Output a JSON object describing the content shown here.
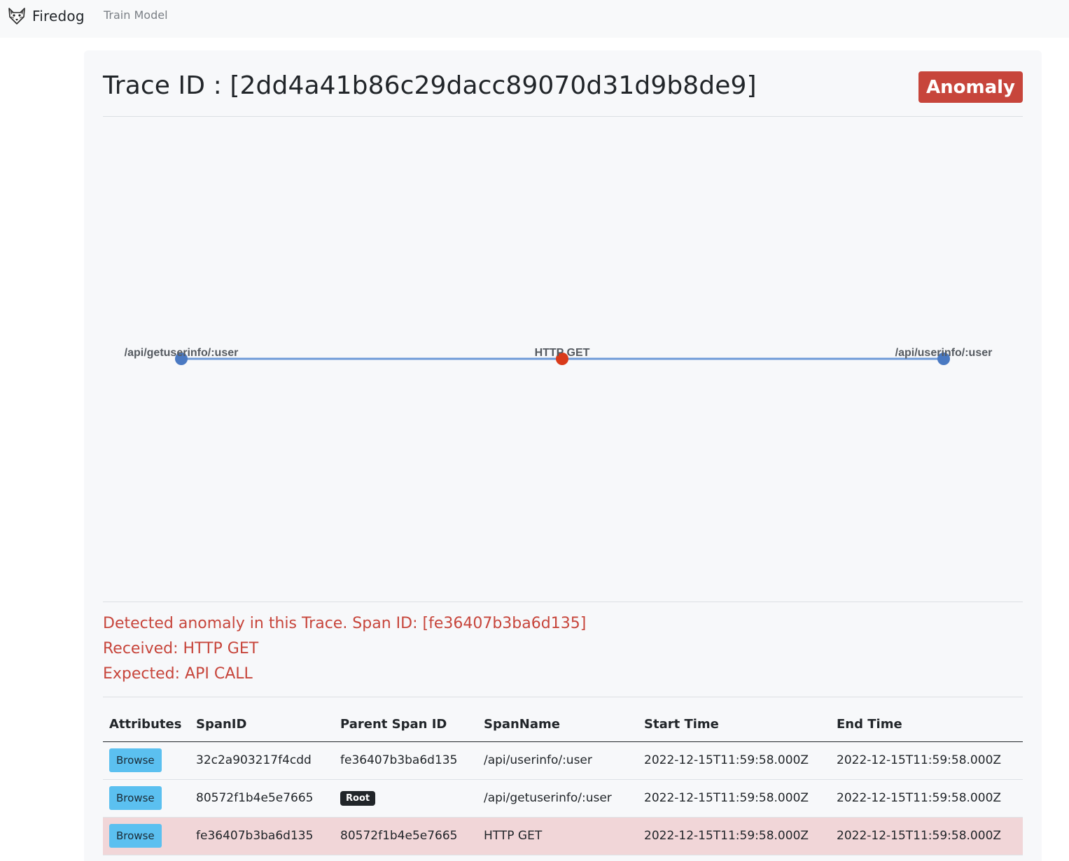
{
  "navbar": {
    "brand": "Firedog",
    "links": [
      "Train Model"
    ]
  },
  "page": {
    "title": "Trace ID : [2dd4a41b86c29dacc89070d31d9b8de9]",
    "status_badge": "Anomaly"
  },
  "graph": {
    "nodes": [
      {
        "label": "/api/getuserinfo/:user",
        "color": "#4a79c2"
      },
      {
        "label": "HTTP GET",
        "color": "#d93a1a"
      },
      {
        "label": "/api/userinfo/:user",
        "color": "#4a79c2"
      }
    ],
    "edge_color": "#6e9ad8"
  },
  "anomaly": {
    "detected": "Detected anomaly in this Trace. Span ID: [fe36407b3ba6d135]",
    "received": "Received: HTTP GET",
    "expected": "Expected: API CALL"
  },
  "table": {
    "headers": [
      "Attributes",
      "SpanID",
      "Parent Span ID",
      "SpanName",
      "Start Time",
      "End Time"
    ],
    "browse_label": "Browse",
    "rows": [
      {
        "span_id": "32c2a903217f4cdd",
        "parent_span_id": "fe36407b3ba6d135",
        "span_name": "/api/userinfo/:user",
        "start_time": "2022-12-15T11:59:58.000Z",
        "end_time": "2022-12-15T11:59:58.000Z"
      },
      {
        "span_id": "80572f1b4e5e7665",
        "parent_span_id": "Root",
        "span_name": "/api/getuserinfo/:user",
        "start_time": "2022-12-15T11:59:58.000Z",
        "end_time": "2022-12-15T11:59:58.000Z"
      },
      {
        "span_id": "fe36407b3ba6d135",
        "parent_span_id": "80572f1b4e5e7665",
        "span_name": "HTTP GET",
        "start_time": "2022-12-15T11:59:58.000Z",
        "end_time": "2022-12-15T11:59:58.000Z"
      }
    ]
  },
  "colors": {
    "danger": "#c7453b",
    "danger_row": "#f1d6d8",
    "info_button": "#5bc0f0"
  }
}
